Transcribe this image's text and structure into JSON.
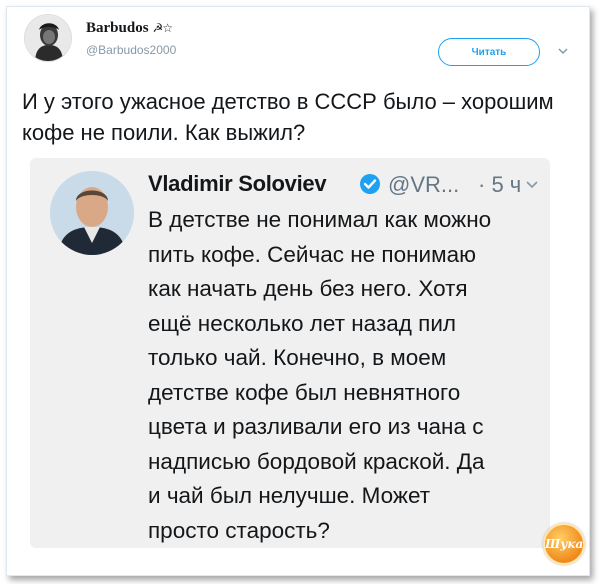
{
  "tweet": {
    "author_name": "Barbudos",
    "author_emoji": "☭☆",
    "author_handle": "@Barbudos2000",
    "follow_label": "Читать",
    "text": "И у этого ужасное детство в СССР было – хорошим кофе не поили. Как выжил?"
  },
  "quoted": {
    "author_name": "Vladimir Soloviev",
    "handle": "@VR...",
    "time": "· 5 ч",
    "text": "В детстве не понимал как можно\nпить кофе. Сейчас не понимаю\nкак начать день без него. Хотя\nещё несколько лет назад пил\nтолько чай. Конечно, в моем\nдетстве кофе был невнятного\nцвета и разливали его из чана  с\nнадписью бордовой краской. Да\nи чай был нелучше. Может\nпросто старость?"
  },
  "watermark": {
    "text": "Шука"
  },
  "colors": {
    "accent": "#1da1f2",
    "text": "#14171a",
    "muted": "#657786"
  }
}
